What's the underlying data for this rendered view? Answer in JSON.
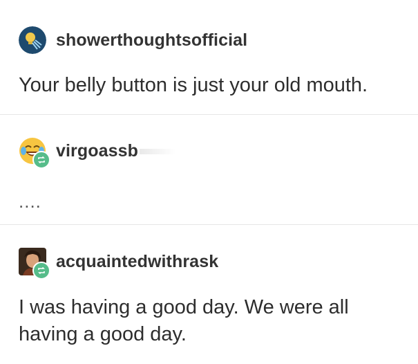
{
  "posts": [
    {
      "username": "showerthoughtsofficial",
      "avatar_icon": "shower-lightbulb-icon",
      "text": "Your belly button is just your old mouth."
    },
    {
      "username": "virgoassb",
      "avatar_icon": "laughing-crying-emoji-icon",
      "reblog_icon": "reblog-icon",
      "text": "...."
    },
    {
      "username": "acquaintedwithrask",
      "avatar_icon": "portrait-painting-icon",
      "reblog_icon": "reblog-icon",
      "text_line1": "I was having a good day. We were all",
      "text_line2": "having a good day."
    }
  ],
  "colors": {
    "reblog_badge": "#56bc8a",
    "divider": "#e6e6e6",
    "avatar1_bg": "#1e4a6e"
  }
}
